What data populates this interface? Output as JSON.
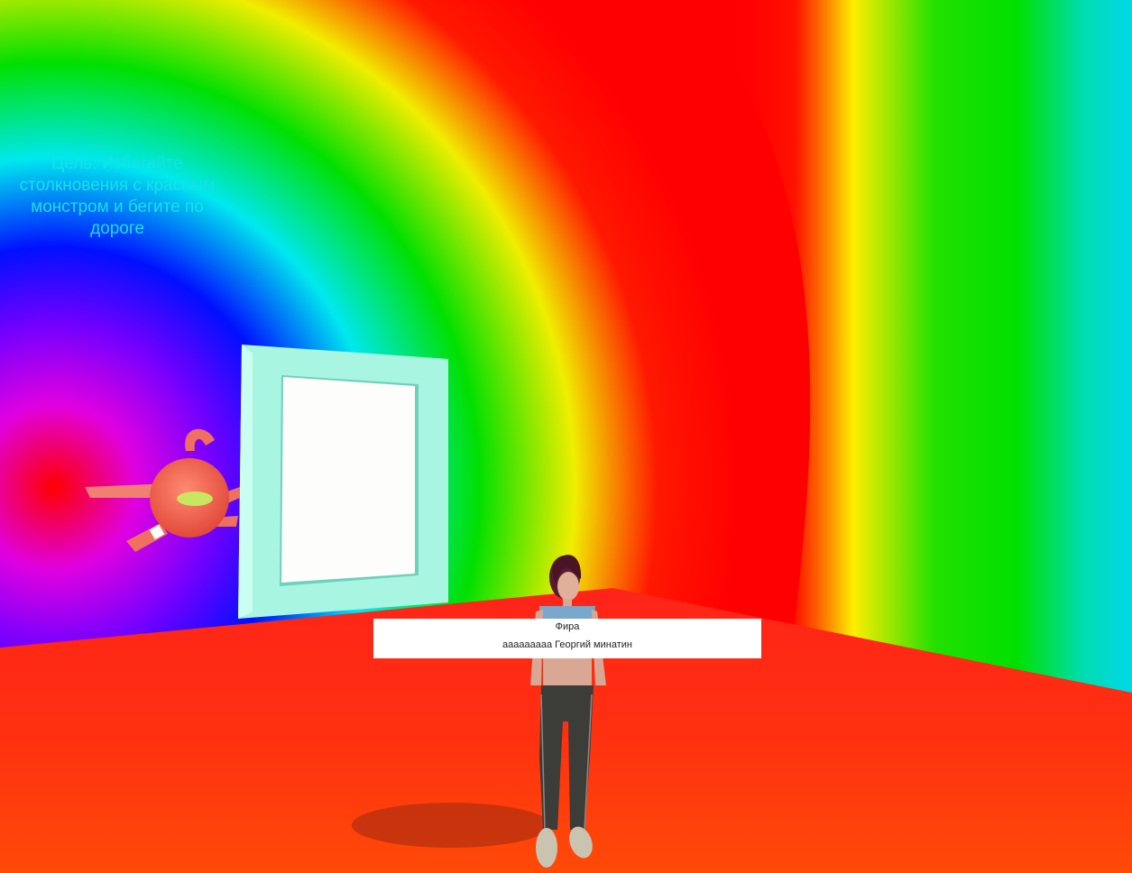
{
  "hud": {
    "objective_text": "Цель: Избегайте столкновения с красным монстром и бегите по дороге"
  },
  "dialog": {
    "speaker": "Фира",
    "line": "ааааааааа Георгий минатин"
  },
  "colors": {
    "floor": "#ff2a1a",
    "door_frame": "#a8f5e2",
    "door_panel": "#fdfdfb",
    "monster": "#f0624f",
    "monster_eye": "#c8e660",
    "objective_text": "#18e0ea"
  },
  "scene": {
    "monster": "red-monster",
    "door": "white-door",
    "character": "player-character"
  }
}
